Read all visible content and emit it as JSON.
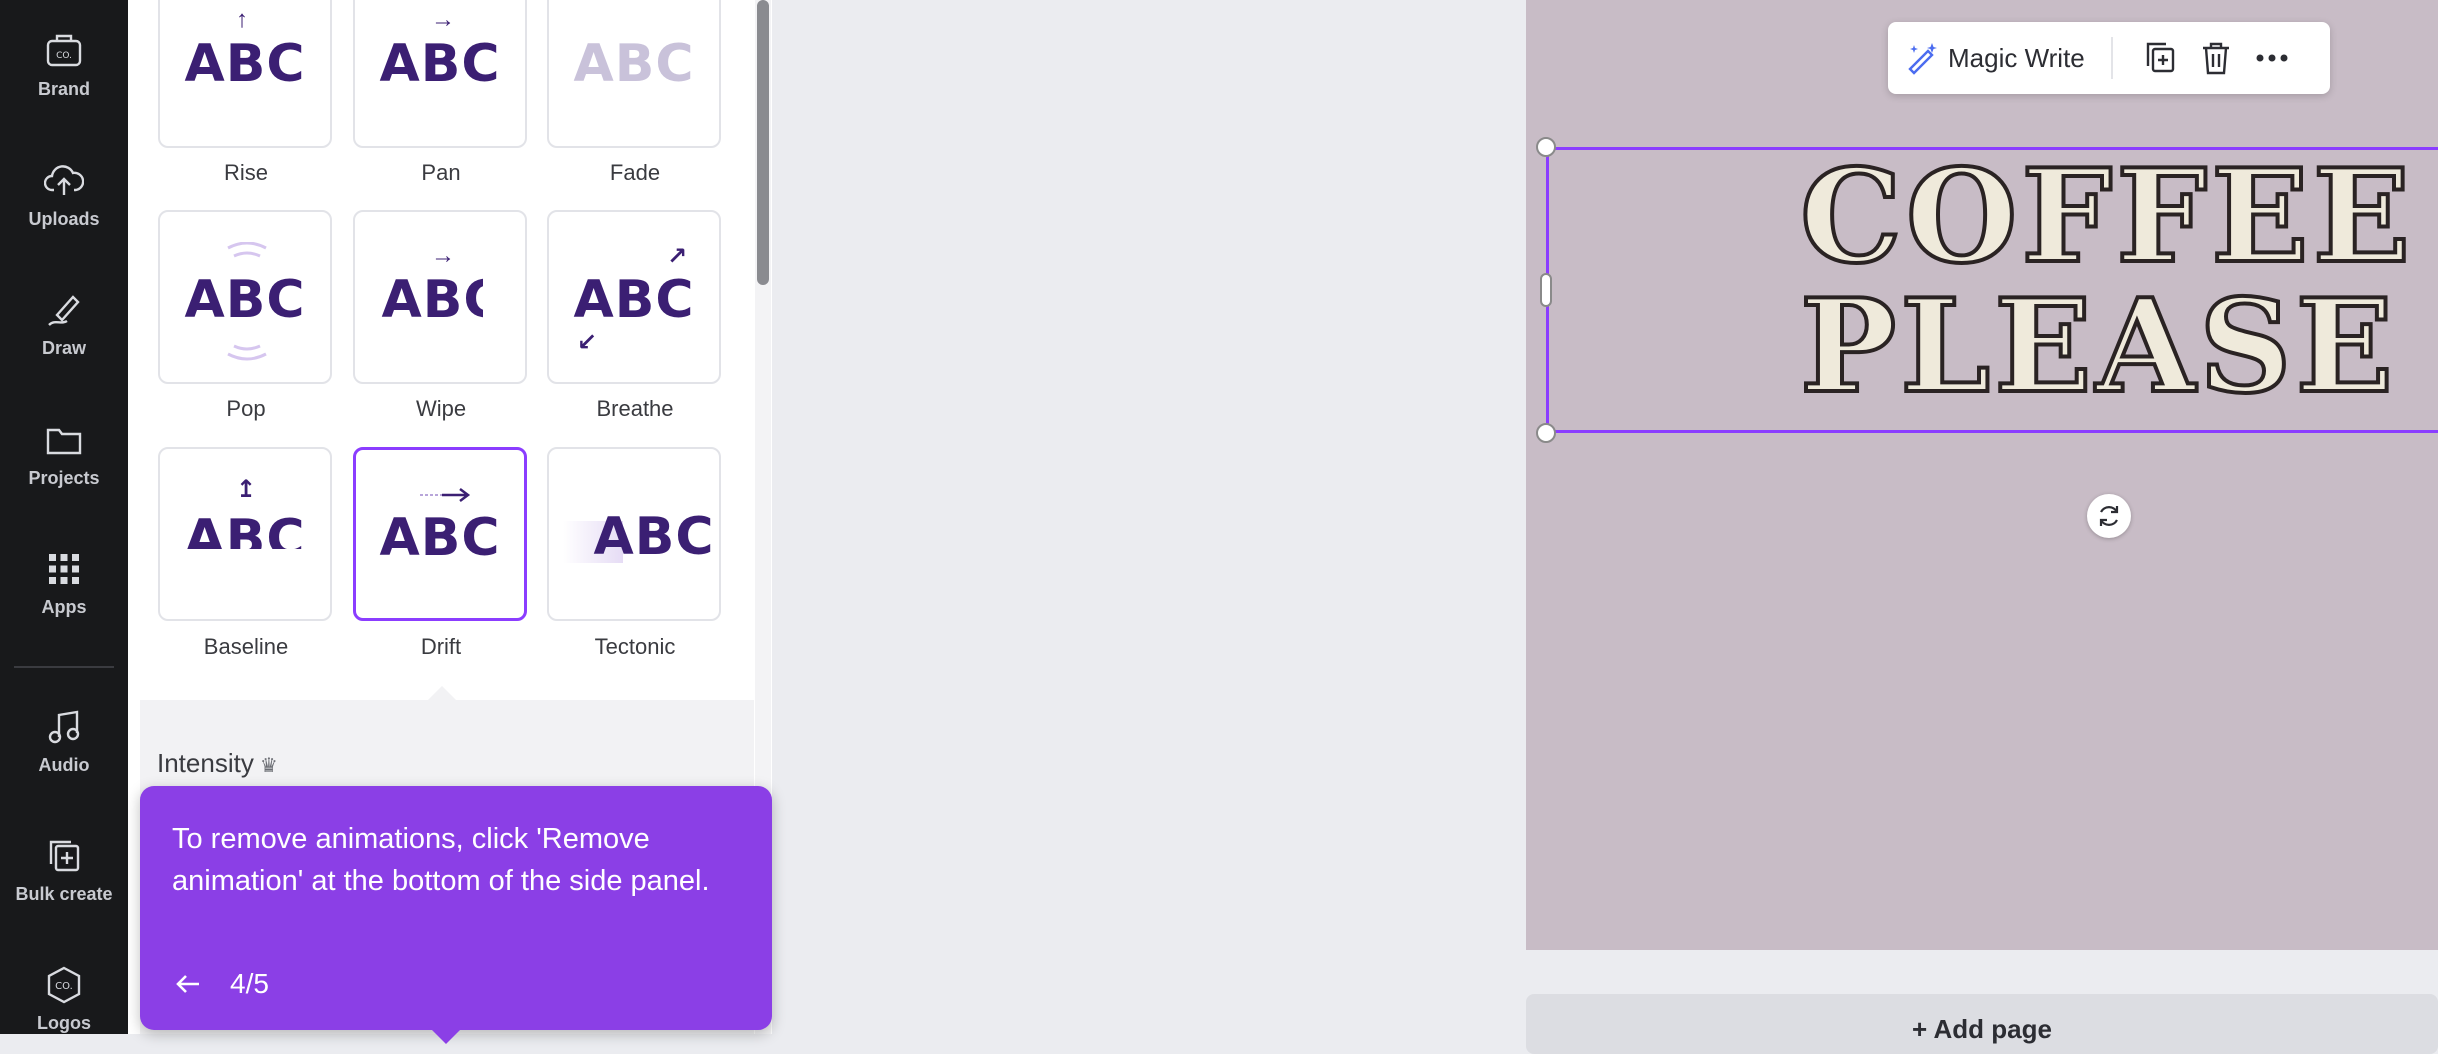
{
  "rail": {
    "items": [
      {
        "label": "Brand",
        "icon": "brand-kit-icon"
      },
      {
        "label": "Uploads",
        "icon": "cloud-upload-icon"
      },
      {
        "label": "Draw",
        "icon": "pen-draw-icon"
      },
      {
        "label": "Projects",
        "icon": "folder-icon"
      },
      {
        "label": "Apps",
        "icon": "apps-grid-icon"
      },
      {
        "label": "Audio",
        "icon": "music-note-icon"
      },
      {
        "label": "Bulk create",
        "icon": "bulk-create-icon"
      },
      {
        "label": "Logos",
        "icon": "logo-badge-icon"
      }
    ],
    "brand_badge": "CO."
  },
  "animations": {
    "sample_text": "ABC",
    "items": [
      {
        "label": "Rise"
      },
      {
        "label": "Pan"
      },
      {
        "label": "Fade"
      },
      {
        "label": "Pop"
      },
      {
        "label": "Wipe"
      },
      {
        "label": "Breathe"
      },
      {
        "label": "Baseline"
      },
      {
        "label": "Drift",
        "selected": true
      },
      {
        "label": "Tectonic"
      }
    ],
    "intensity_label": "Intensity"
  },
  "tooltip": {
    "text": "To remove animations, click 'Remove animation' at the bottom of the side panel.",
    "step": "4/5",
    "color": "#8b3fe6"
  },
  "toolbar": {
    "magic_write_label": "Magic Write"
  },
  "canvas": {
    "line1": "COFFEE",
    "line2": "PLEASE",
    "background": "#c8bcc6",
    "add_page_label": "+ Add page"
  },
  "colors": {
    "accent": "#8b3dff",
    "rail_bg": "#18191b",
    "abc_text": "#3b1f73"
  }
}
